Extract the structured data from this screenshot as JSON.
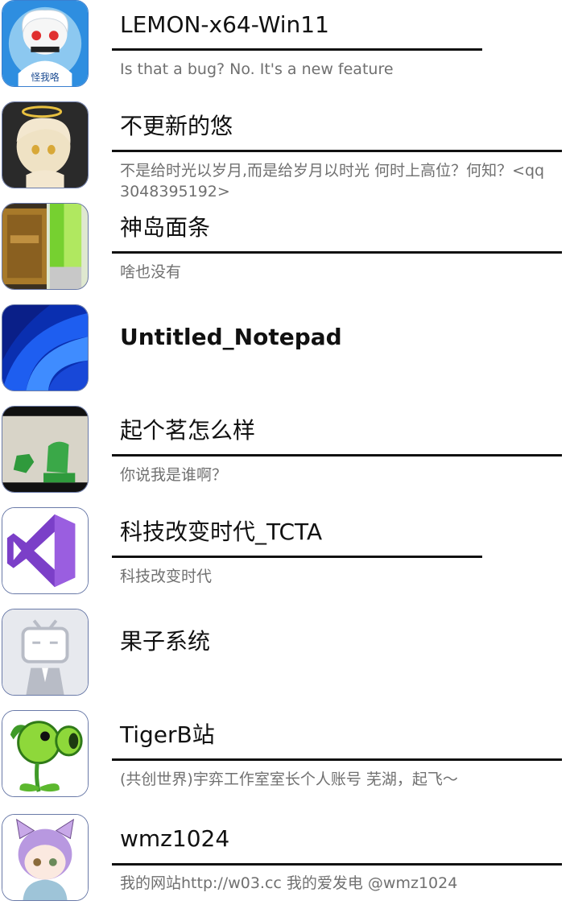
{
  "profiles": [
    {
      "name": "LEMON-x64-Win11",
      "bio": "Is that a bug?   No. It's a new feature",
      "avatar": "seal-girl-avatar",
      "avatar_caption": "怪我咯"
    },
    {
      "name": "不更新的悠",
      "bio": "不是给时光以岁月,而是给岁月以时光 何时上高位？何知？<qq 3048395192>",
      "avatar": "angel-chibi-avatar"
    },
    {
      "name": "神岛面条",
      "bio": "啥也没有",
      "avatar": "pixel-block-avatar"
    },
    {
      "name": "Untitled_Notepad",
      "bio": "",
      "avatar": "windows11-wallpaper-avatar"
    },
    {
      "name": "起个茗怎么样",
      "bio": "你说我是谁啊？",
      "avatar": "green-hands-avatar"
    },
    {
      "name": "科技改变时代_TCTA",
      "bio": "科技改变时代",
      "avatar": "visual-studio-avatar"
    },
    {
      "name": "果子系统",
      "bio": "",
      "avatar": "bilibili-default-avatar"
    },
    {
      "name": "TigerB站",
      "bio": "(共创世界)宇弈工作室室长个人账号  芜湖，起飞～",
      "avatar": "peashooter-avatar"
    },
    {
      "name": "wmz1024",
      "bio": "我的网站http://w03.cc  我的爱发电 @wmz1024",
      "avatar": "cat-ear-boy-avatar"
    }
  ],
  "colors": {
    "text": "#111111",
    "bio": "#707070",
    "rule": "#111111",
    "avatar_border": "#6a7aa8"
  }
}
